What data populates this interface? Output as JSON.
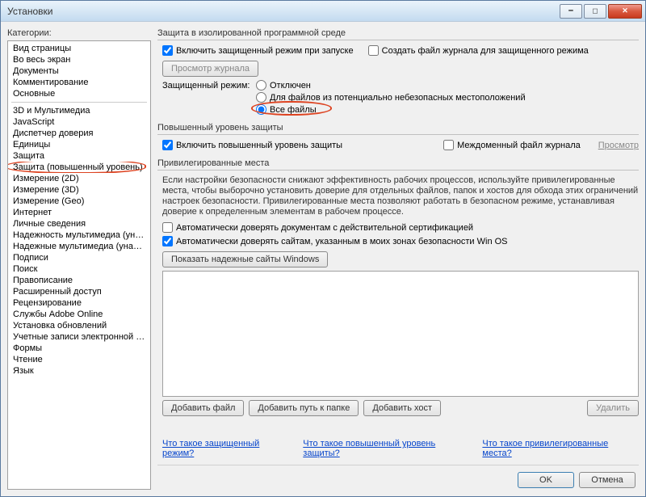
{
  "window": {
    "title": "Установки"
  },
  "sidebar": {
    "label": "Категории:",
    "group1": [
      "Вид страницы",
      "Во весь экран",
      "Документы",
      "Комментирование",
      "Основные"
    ],
    "group2": [
      "3D и Мультимедиа",
      "JavaScript",
      "Диспетчер доверия",
      "Единицы",
      "Защита",
      "Защита (повышенный уровень)",
      "Измерение (2D)",
      "Измерение (3D)",
      "Измерение (Geo)",
      "Интернет",
      "Личные сведения",
      "Надежность мультимедиа (унаслед.)",
      "Надежные мультимедиа (унаслед.)",
      "Подписи",
      "Поиск",
      "Правописание",
      "Расширенный доступ",
      "Рецензирование",
      "Службы Adobe Online",
      "Установка обновлений",
      "Учетные записи электронной почты",
      "Формы",
      "Чтение",
      "Язык"
    ],
    "highlight": "Защита (повышенный уровень)"
  },
  "sandbox": {
    "title": "Защита в изолированной программной среде",
    "enable_protected": "Включить защищенный режим при запуске",
    "create_log": "Создать файл журнала для защищенного режима",
    "view_log": "Просмотр журнала",
    "mode_label": "Защищенный режим:",
    "opt_off": "Отключен",
    "opt_unsafe": "Для файлов из потенциально небезопасных местоположений",
    "opt_all": "Все файлы"
  },
  "enhanced": {
    "title": "Повышенный уровень защиты",
    "enable": "Включить повышенный уровень защиты",
    "crossdomain": "Междоменный файл журнала",
    "view": "Просмотр"
  },
  "priv": {
    "title": "Привилегированные места",
    "desc": "Если настройки безопасности снижают эффективность рабочих процессов, используйте привилегированные места, чтобы выборочно установить доверие для отдельных файлов, папок и хостов для обхода этих ограничений настроек безопасности. Привилегированные места позволяют работать в безопасном режиме, устанавливая доверие к определенным элементам в рабочем процессе.",
    "trust_cert": "Автоматически доверять документам с действительной сертификацией",
    "trust_winos": "Автоматически доверять сайтам, указанным в моих зонах безопасности Win OS",
    "show_trusted": "Показать надежные сайты Windows",
    "add_file": "Добавить файл",
    "add_folder": "Добавить путь к папке",
    "add_host": "Добавить хост",
    "remove": "Удалить"
  },
  "links": {
    "what_protected": "Что такое защищенный режим?",
    "what_enhanced": "Что такое повышенный уровень защиты?",
    "what_priv": "Что такое привилегированные места?"
  },
  "dialog": {
    "ok": "OK",
    "cancel": "Отмена"
  }
}
